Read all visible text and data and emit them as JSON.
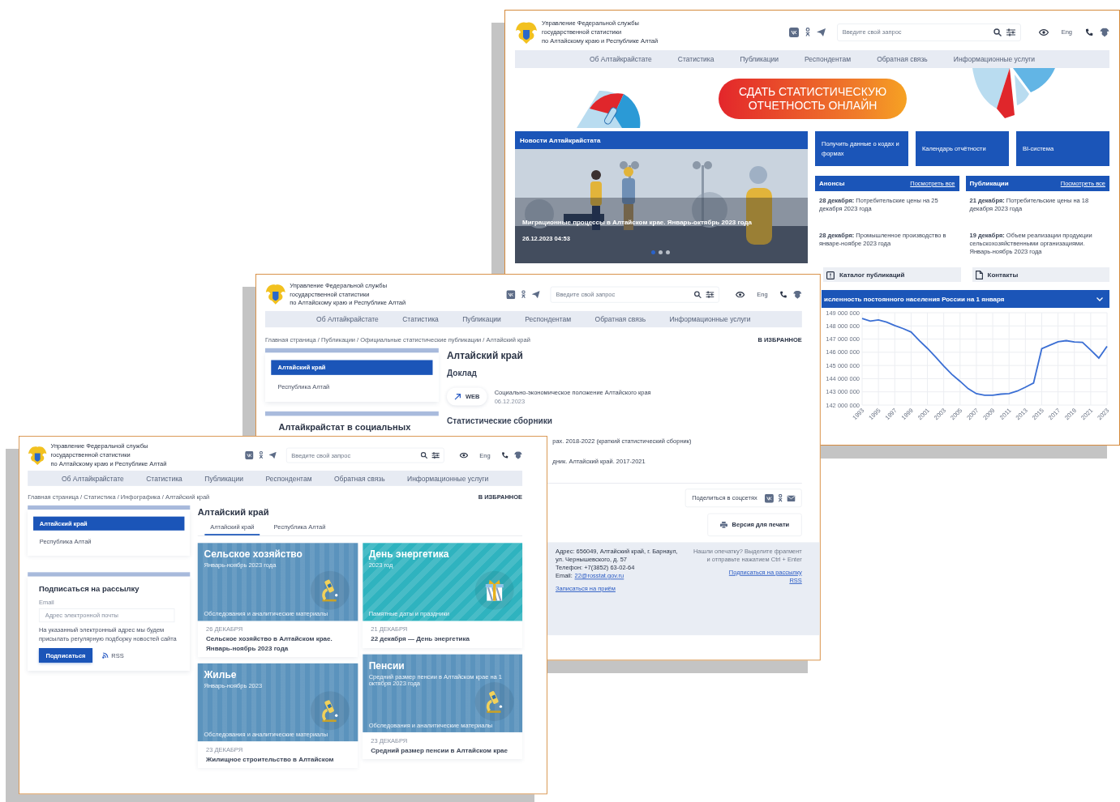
{
  "home_page": {
    "header": {
      "title_lines": [
        "Управление Федеральной службы",
        "государственной статистики",
        "по Алтайскому краю и Республике Алтай"
      ],
      "search": {
        "placeholder": "Введите свой запрос"
      },
      "language": "Eng"
    },
    "nav": [
      "Об Алтайкрайстате",
      "Статистика",
      "Публикации",
      "Респондентам",
      "Обратная связь",
      "Информационные услуги"
    ],
    "banner_button": "СДАТЬ СТАТИСТИЧЕСКУЮ ОТЧЕТНОСТЬ ОНЛАЙН",
    "news": {
      "title": "Новости Алтайкрайстата",
      "slide_title": "Миграционные процессы в Алтайском крае. Январь-октябрь 2023 года",
      "slide_date": "26.12.2023 04:53",
      "dots": [
        {
          "selected": true
        },
        {
          "selected": false
        },
        {
          "selected": false
        }
      ]
    },
    "quick_links": [
      "Получить данные о кодах и формах",
      "Календарь отчётности",
      "BI-система"
    ],
    "feeds": [
      {
        "title": "Анонсы",
        "link": "Посмотреть все",
        "items": [
          "**28 декабря:** Потребительские цены на 25 декабря 2023 года",
          "**28 декабря:** Промышленное производство в январе-ноябре 2023 года"
        ]
      },
      {
        "title": "Публикации",
        "link": "Посмотреть все",
        "items": [
          "**21 декабря:** Потребительские цены на 18 декабря 2023 года",
          "**19 декабря:** Объем реализации продукции сельскохозяйственными организациями. Январь-ноябрь 2023 года"
        ]
      }
    ],
    "shortcuts": [
      {
        "label": "Каталог публикаций",
        "kind": "alert"
      },
      {
        "label": "Контакты",
        "kind": "document"
      }
    ],
    "chart": {
      "title": "исленность постоянного населения России на 1 января",
      "chart_data": {
        "type": "line",
        "x": [
          1993,
          1994,
          1995,
          1996,
          1997,
          1998,
          1999,
          2000,
          2001,
          2002,
          2003,
          2004,
          2005,
          2006,
          2007,
          2008,
          2009,
          2010,
          2011,
          2012,
          2013,
          2014,
          2015,
          2016,
          2017,
          2018,
          2019,
          2020,
          2021,
          2022,
          2023
        ],
        "series": [
          {
            "color": "#3b6fd4",
            "values": [
              148560000,
              148360000,
              148460000,
              148290000,
              148030000,
              147800000,
              147540000,
              146890000,
              146300000,
              145650000,
              144960000,
              144330000,
              143800000,
              143240000,
              142860000,
              142750000,
              142740000,
              142830000,
              142870000,
              143060000,
              143350000,
              143670000,
              146270000,
              146540000,
              146800000,
              146880000,
              146780000,
              146750000,
              146170000,
              145560000,
              146450000
            ]
          }
        ],
        "xlim": [
          1993,
          2023
        ],
        "ylim": [
          142000000,
          149000000
        ],
        "grid": true,
        "yticks": [
          {
            "value": 142000000,
            "label": "142 000 000"
          },
          {
            "value": 143000000,
            "label": "143 000 000"
          },
          {
            "value": 144000000,
            "label": "144 000 000"
          },
          {
            "value": 145000000,
            "label": "145 000 000"
          },
          {
            "value": 146000000,
            "label": "146 000 000"
          },
          {
            "value": 147000000,
            "label": "147 000 000"
          },
          {
            "value": 148000000,
            "label": "148 000 000"
          },
          {
            "value": 149000000,
            "label": "149 000 000"
          }
        ],
        "xticks": [
          1993,
          1995,
          1997,
          1999,
          2001,
          2003,
          2005,
          2007,
          2009,
          2011,
          2013,
          2015,
          2017,
          2019,
          2021,
          2023
        ]
      }
    }
  },
  "report_page": {
    "header": {
      "title_lines": [
        "Управление Федеральной службы",
        "государственной статистики",
        "по Алтайскому краю и Республике Алтай"
      ],
      "search": {
        "placeholder": "Введите свой запрос"
      },
      "language": "Eng"
    },
    "nav": [
      "Об Алтайкрайстате",
      "Статистика",
      "Публикации",
      "Респондентам",
      "Обратная связь",
      "Информационные услуги"
    ],
    "breadcrumb": "Главная страница / Публикации / Официальные статистические публикации / Алтайский край",
    "favorite": "В ИЗБРАННОЕ",
    "sidebar": [
      {
        "label": "Алтайский край",
        "selected": true
      },
      {
        "label": "Республика Алтай",
        "selected": false
      }
    ],
    "sidebar_heading": "Алтайкрайстат в социальных",
    "title": "Алтайский край",
    "section": "Доклад",
    "report": {
      "badge": "WEB",
      "title": "Социально-экономическое положение Алтайского края",
      "date": "06.12.2023"
    },
    "section_2": "Статистические сборники",
    "collections": [
      "рах. 2018-2022 (краткий статистический сборник)",
      "дник. Алтайский край. 2017-2021"
    ],
    "share": "Поделиться в соцсетях",
    "print_button": "Версия для печати",
    "footer": {
      "address_lines": [
        "Адрес: 656049, Алтайский край, г. Барнаул,",
        "ул. Чернышевского, д. 57",
        "Телефон: +7(3852) 63-02-64"
      ],
      "email_label": "Email:",
      "email": "22@rosstat.gov.ru",
      "appointment": "Записаться на приём",
      "typo_note": [
        "Нашли опечатку? Выделите фрагмент",
        "и отправьте нажатием Ctrl + Enter"
      ],
      "links": [
        "Подписаться на рассылку",
        "RSS"
      ]
    }
  },
  "infographics_page": {
    "header": {
      "title_lines": [
        "Управление Федеральной службы",
        "государственной статистики",
        "по Алтайскому краю и Республике Алтай"
      ],
      "search": {
        "placeholder": "Введите свой запрос"
      },
      "language": "Eng"
    },
    "nav": [
      "Об Алтайкрайстате",
      "Статистика",
      "Публикации",
      "Респондентам",
      "Обратная связь",
      "Информационные услуги"
    ],
    "breadcrumb": "Главная страница / Статистика / Инфографика / Алтайский край",
    "favorite": "В ИЗБРАННОЕ",
    "sidebar": [
      {
        "label": "Алтайский край",
        "selected": true
      },
      {
        "label": "Республика Алтай",
        "selected": false
      }
    ],
    "subscribe": {
      "title": "Подписаться на рассылку",
      "email_label": "Email",
      "placeholder": "Адрес электронной почты",
      "note": "На указанный электронный адрес мы будем присылать регулярную подборку новостей сайта",
      "button": "Подписаться",
      "rss": "RSS"
    },
    "title": "Алтайский край",
    "tabs": [
      {
        "label": "Алтайский край",
        "selected": true
      },
      {
        "label": "Республика Алтай",
        "selected": false
      }
    ],
    "cards": [
      {
        "title": "Сельское хозяйство",
        "subtitle": "Январь-ноябрь 2023 года",
        "tag": "Обследования и аналитические материалы",
        "color": "#5b93bd",
        "kind": "microscope",
        "date": "26 ДЕКАБРЯ",
        "caption": "Сельское хозяйство в Алтайском крае. Январь-ноябрь 2023 года"
      },
      {
        "title": "Жилье",
        "subtitle": "Январь-ноябрь 2023",
        "tag": "Обследования и аналитические материалы",
        "color": "#5b93bd",
        "kind": "microscope",
        "date": "23 ДЕКАБРЯ",
        "caption": "Жилищное строительство в Алтайском"
      },
      {
        "title": "День энергетика",
        "subtitle": "2023 год",
        "tag": "Памятные даты и праздники",
        "color": "#2fb3bf",
        "kind": "gift",
        "date": "21 ДЕКАБРЯ",
        "caption": "22 декабря — День энергетика"
      },
      {
        "title": "Пенсии",
        "subtitle": "Средний размер пенсии в Алтайском крае на 1 октября 2023 года",
        "tag": "Обследования и аналитические материалы",
        "color": "#5b93bd",
        "kind": "microscope",
        "date": "23 ДЕКАБРЯ",
        "caption": "Средний размер пенсии в Алтайском крае"
      }
    ]
  }
}
